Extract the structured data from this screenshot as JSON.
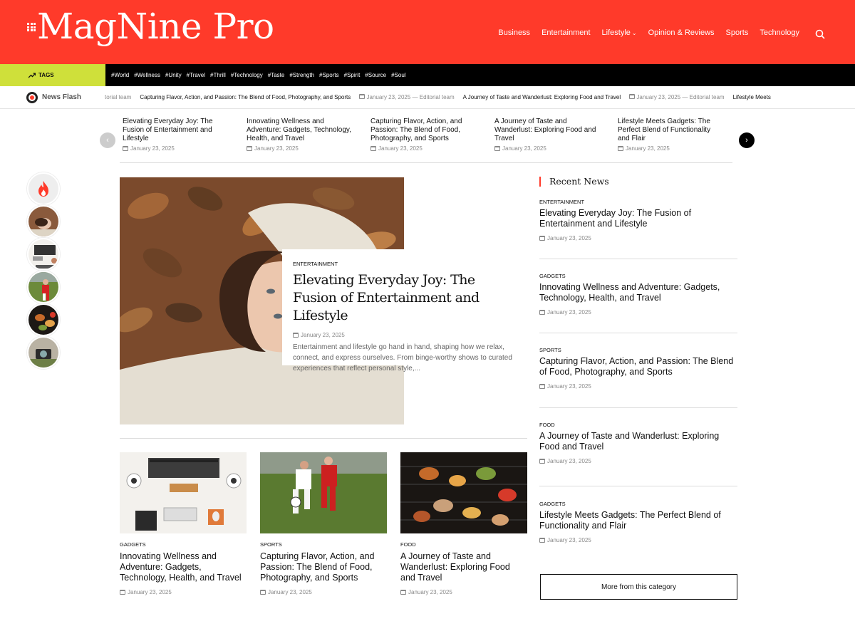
{
  "site": {
    "logo": "MagNine Pro"
  },
  "nav": [
    "Business",
    "Entertainment",
    "Lifestyle",
    "Opinion & Reviews",
    "Sports",
    "Technology"
  ],
  "tags": {
    "label": "TAGS",
    "items": [
      "#World",
      "#Wellness",
      "#Unity",
      "#Travel",
      "#Thrill",
      "#Technology",
      "#Taste",
      "#Strength",
      "#Sports",
      "#Spirit",
      "#Source",
      "#Soul"
    ]
  },
  "news_flash": {
    "label": "News Flash",
    "items": [
      {
        "title": "torial team",
        "meta": ""
      },
      {
        "title": "Capturing Flavor, Action, and Passion: The Blend of Food, Photography, and Sports",
        "meta": "January 23, 2025 — Editorial team"
      },
      {
        "title": "A Journey of Taste and Wanderlust: Exploring Food and Travel",
        "meta": "January 23, 2025 — Editorial team"
      },
      {
        "title": "Lifestyle Meets",
        "meta": ""
      }
    ]
  },
  "carousel": [
    {
      "title": "Elevating Everyday Joy: The Fusion of Entertainment and Lifestyle",
      "date": "January 23, 2025"
    },
    {
      "title": "Innovating Wellness and Adventure: Gadgets, Technology, Health, and Travel",
      "date": "January 23, 2025"
    },
    {
      "title": "Capturing Flavor, Action, and Passion: The Blend of Food, Photography, and Sports",
      "date": "January 23, 2025"
    },
    {
      "title": "A Journey of Taste and Wanderlust: Exploring Food and Travel",
      "date": "January 23, 2025"
    },
    {
      "title": "Lifestyle Meets Gadgets: The Perfect Blend of Functionality and Flair",
      "date": "January 23, 2025"
    }
  ],
  "hero": {
    "category": "ENTERTAINMENT",
    "title": "Elevating Everyday Joy: The Fusion of Entertainment and Lifestyle",
    "date": "January 23, 2025",
    "excerpt": "Entertainment and lifestyle go hand in hand, shaping how we relax, connect, and express ourselves. From binge-worthy shows to curated experiences that reflect personal style,..."
  },
  "cards": [
    {
      "category": "GADGETS",
      "title": "Innovating Wellness and Adventure: Gadgets, Technology, Health, and Travel",
      "date": "January 23, 2025"
    },
    {
      "category": "SPORTS",
      "title": "Capturing Flavor, Action, and Passion: The Blend of Food, Photography, and Sports",
      "date": "January 23, 2025"
    },
    {
      "category": "FOOD",
      "title": "A Journey of Taste and Wanderlust: Exploring Food and Travel",
      "date": "January 23, 2025"
    }
  ],
  "recent_news": {
    "heading": "Recent News",
    "items": [
      {
        "category": "ENTERTAINMENT",
        "title": "Elevating Everyday Joy: The Fusion of Entertainment and Lifestyle",
        "date": "January 23, 2025"
      },
      {
        "category": "GADGETS",
        "title": "Innovating Wellness and Adventure: Gadgets, Technology, Health, and Travel",
        "date": "January 23, 2025"
      },
      {
        "category": "SPORTS",
        "title": "Capturing Flavor, Action, and Passion: The Blend of Food, Photography, and Sports",
        "date": "January 23, 2025"
      },
      {
        "category": "FOOD",
        "title": "A Journey of Taste and Wanderlust: Exploring Food and Travel",
        "date": "January 23, 2025"
      },
      {
        "category": "GADGETS",
        "title": "Lifestyle Meets Gadgets: The Perfect Blend of Functionality and Flair",
        "date": "January 23, 2025"
      }
    ],
    "more_label": "More from this category"
  },
  "colors": {
    "brand": "#ff3a2a",
    "tags_accent": "#cfe03a"
  }
}
